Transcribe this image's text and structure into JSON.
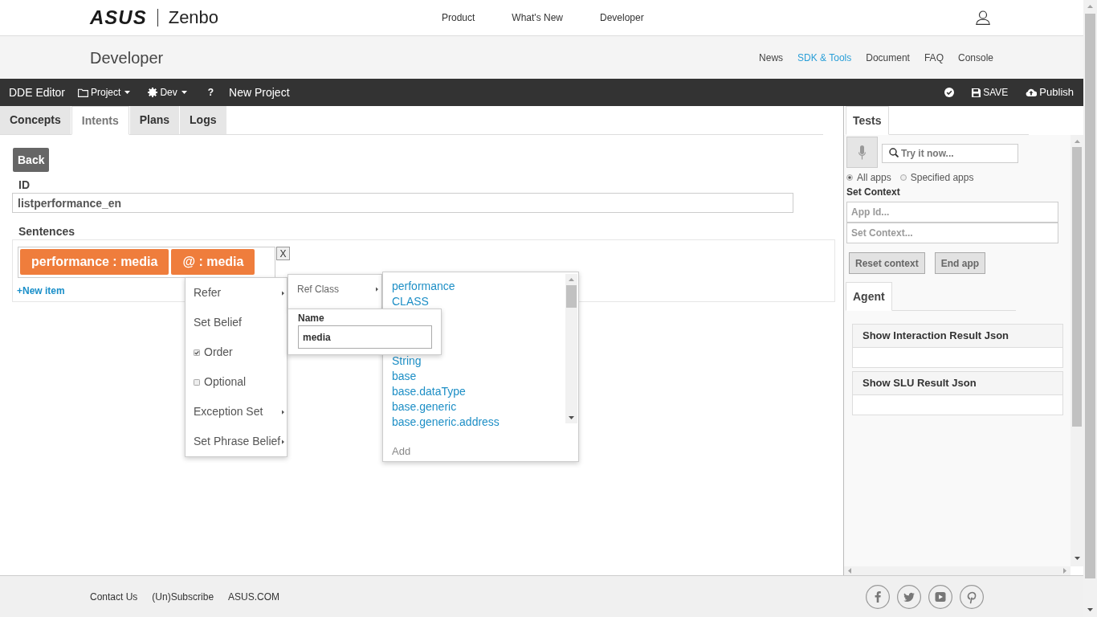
{
  "header": {
    "logo_brand": "ASUS",
    "logo_product": "Zenbo",
    "nav": [
      "Product",
      "What's New",
      "Developer"
    ]
  },
  "subheader": {
    "title": "Developer",
    "links": [
      {
        "label": "News",
        "selected": false
      },
      {
        "label": "SDK & Tools",
        "selected": true
      },
      {
        "label": "Document",
        "selected": false
      },
      {
        "label": "FAQ",
        "selected": false
      },
      {
        "label": "Console",
        "selected": false
      }
    ]
  },
  "toolbar": {
    "title": "DDE Editor",
    "menus": [
      {
        "label": "Project",
        "kind": "folder"
      },
      {
        "label": "Dev",
        "kind": "gear"
      }
    ],
    "help": "?",
    "project_name": "New Project",
    "actions": [
      {
        "kind": "check"
      },
      {
        "label": "SAVE",
        "kind": "save"
      },
      {
        "label": "Publish",
        "kind": "publish"
      }
    ]
  },
  "editor": {
    "tabs": [
      {
        "label": "Concepts",
        "selected": false
      },
      {
        "label": "Intents",
        "selected": true
      },
      {
        "label": "Plans",
        "selected": false
      },
      {
        "label": "Logs",
        "selected": false
      }
    ],
    "back_button": "Back",
    "id_label": "ID",
    "id_value": "listperformance_en",
    "sentences_label": "Sentences",
    "sentence_tags": [
      "performance : media",
      "@ : media"
    ],
    "remove_button": "X",
    "new_item": "+New item"
  },
  "context_menu": {
    "items": [
      {
        "label": "Refer",
        "kind": "submenu"
      },
      {
        "label": "Set Belief",
        "kind": "plain"
      },
      {
        "label": "Order",
        "kind": "checkbox",
        "checked": true
      },
      {
        "label": "Optional",
        "kind": "checkbox",
        "checked": false
      },
      {
        "label": "Exception Set",
        "kind": "submenu"
      },
      {
        "label": "Set Phrase Belief",
        "kind": "submenu"
      }
    ]
  },
  "submenu": {
    "items": [
      {
        "label": "Ref Class",
        "kind": "submenu"
      }
    ]
  },
  "name_popup": {
    "label": "Name",
    "value": "media"
  },
  "class_list": {
    "items": [
      "performance",
      "CLASS",
      "String",
      "base",
      "base.dataType",
      "base.generic",
      "base.generic.address"
    ],
    "add": "Add"
  },
  "tests_panel": {
    "tabs": [
      {
        "label": "Tests",
        "selected": true
      }
    ],
    "search": {
      "placeholder": "Try it now..."
    },
    "scope": [
      {
        "label": "All apps",
        "selected": true
      },
      {
        "label": "Specified apps",
        "selected": false
      }
    ],
    "context_label": "Set Context",
    "fields": [
      {
        "placeholder": "App Id..."
      },
      {
        "placeholder": "Set Context..."
      }
    ],
    "buttons": [
      "Reset context",
      "End app"
    ]
  },
  "agent_panel": {
    "tabs": [
      {
        "label": "Agent",
        "selected": true
      }
    ],
    "panels": [
      {
        "title": "Show Interaction Result Json"
      },
      {
        "title": "Show SLU Result Json"
      }
    ]
  },
  "footer": {
    "links": [
      "Contact Us",
      "(Un)Subscribe",
      "ASUS.COM"
    ],
    "social": [
      {
        "kind": "facebook"
      },
      {
        "kind": "twitter"
      },
      {
        "kind": "youtube"
      },
      {
        "kind": "pinterest"
      }
    ]
  }
}
